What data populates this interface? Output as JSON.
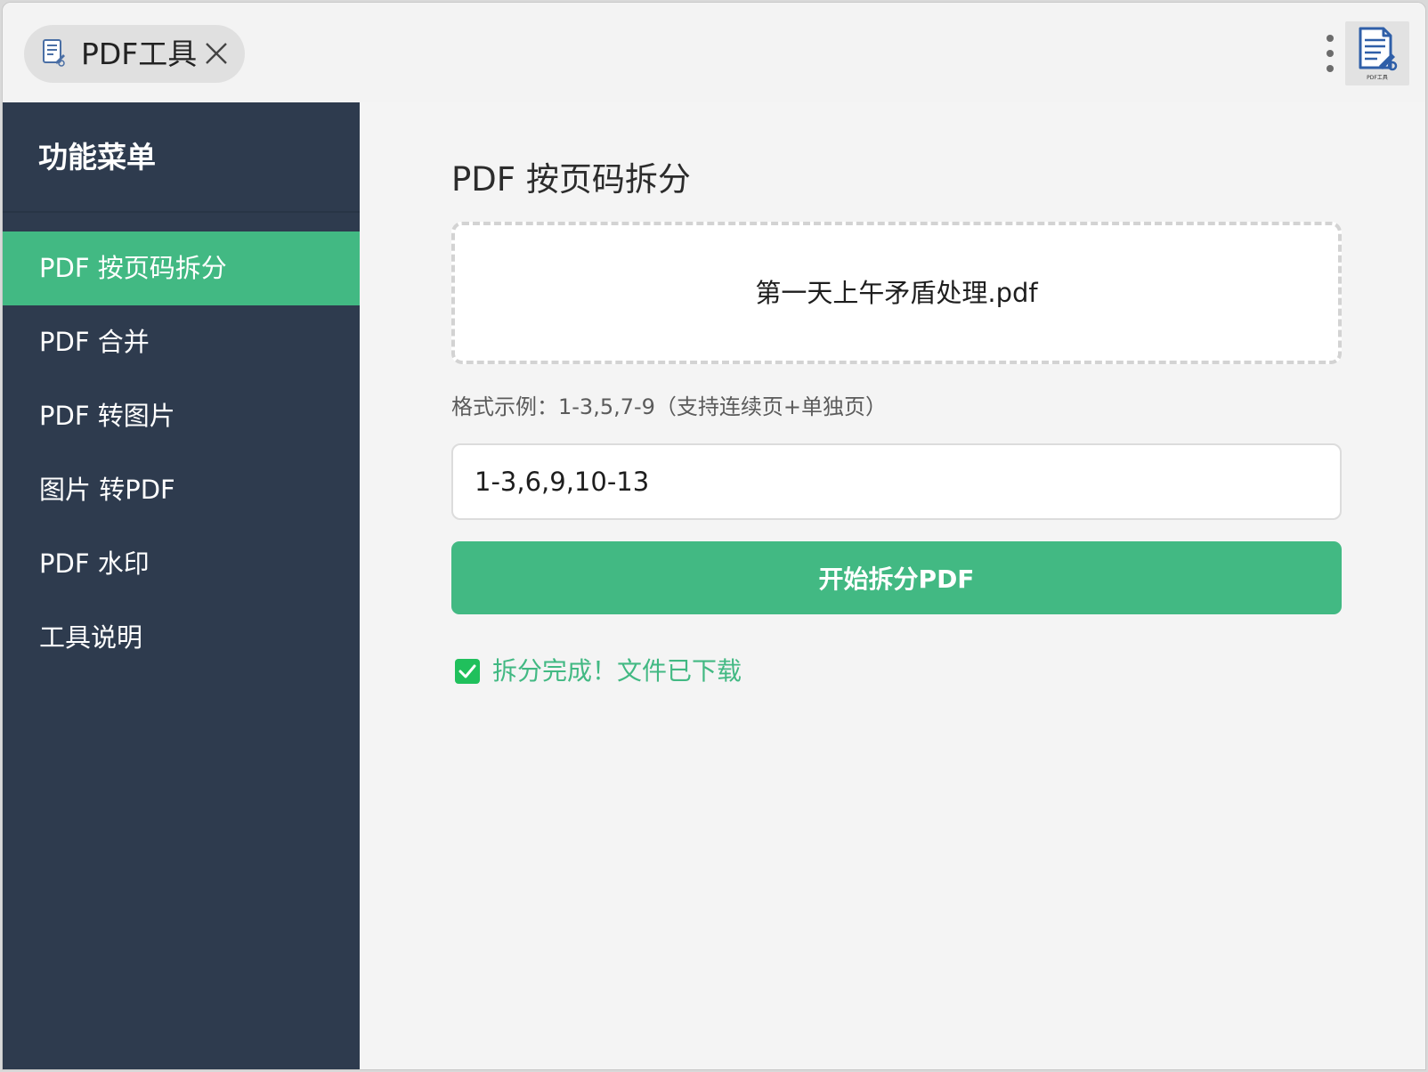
{
  "titlebar": {
    "tab_title": "PDF工具",
    "tab_icon": "document-edit-icon",
    "close_icon": "close-icon",
    "more_icon": "more-vertical-icon",
    "extension_icon": "pdf-tool-extension-icon",
    "extension_icon_caption": "PDF工具"
  },
  "sidebar": {
    "title": "功能菜单",
    "items": [
      {
        "label": "PDF 按页码拆分",
        "active": true
      },
      {
        "label": "PDF 合并",
        "active": false
      },
      {
        "label": "PDF 转图片",
        "active": false
      },
      {
        "label": "图片 转PDF",
        "active": false
      },
      {
        "label": "PDF 水印",
        "active": false
      },
      {
        "label": "工具说明",
        "active": false
      }
    ]
  },
  "main": {
    "title": "PDF 按页码拆分",
    "dropzone": {
      "file_name": "第一天上午矛盾处理.pdf"
    },
    "format_hint": "格式示例：1-3,5,7-9（支持连续页+单独页）",
    "pages_input": {
      "value": "1-3,6,9,10-13",
      "placeholder": ""
    },
    "split_button_label": "开始拆分PDF",
    "status": {
      "icon": "checkbox-checked-icon",
      "text": "拆分完成！文件已下载"
    }
  },
  "colors": {
    "accent": "#42b983",
    "sidebar_bg": "#2e3b4e",
    "main_bg": "#f4f4f4",
    "titlebar_bg": "#f3f3f3"
  }
}
